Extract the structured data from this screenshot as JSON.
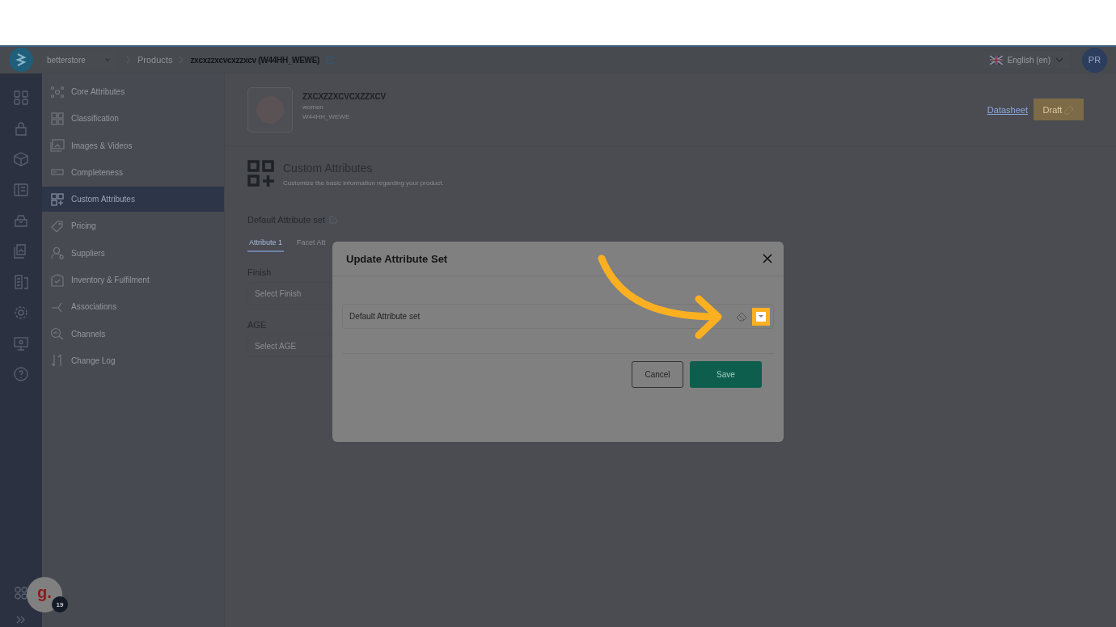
{
  "topbar": {
    "store": "betterstore",
    "breadcrumb": [
      "Products",
      "zxcxzzxcvcxzzxcv (W44HH_WEWE)"
    ],
    "language": "English (en)",
    "avatar": "PR"
  },
  "sidebar": {
    "items": [
      {
        "label": "Core Attributes",
        "selected": false
      },
      {
        "label": "Classification",
        "selected": false
      },
      {
        "label": "Images & Videos",
        "selected": false
      },
      {
        "label": "Completeness",
        "selected": false
      },
      {
        "label": "Custom Attributes",
        "selected": true
      },
      {
        "label": "Pricing",
        "selected": false
      },
      {
        "label": "Suppliers",
        "selected": false
      },
      {
        "label": "Inventory & Fulfilment",
        "selected": false
      },
      {
        "label": "Associations",
        "selected": false
      },
      {
        "label": "Channels",
        "selected": false
      },
      {
        "label": "Change Log",
        "selected": false
      }
    ]
  },
  "product": {
    "name": "ZXCXZZXCVCXZZXCV",
    "category": "women",
    "sku": "W44HH_WEWE",
    "link": "Datasheet",
    "status": "Draft"
  },
  "section": {
    "title": "Custom Attributes",
    "subtitle": "Customize the basic information regarding your product.",
    "attribute_set": "Default Attribute set"
  },
  "tabs": [
    {
      "label": "Attribute 1",
      "selected": true
    },
    {
      "label": "Facet Att",
      "selected": false
    }
  ],
  "fields": [
    {
      "label": "Finish",
      "placeholder": "Select Finish"
    },
    {
      "label": "AGE",
      "placeholder": "Select AGE"
    }
  ],
  "modal": {
    "title": "Update Attribute Set",
    "value": "Default Attribute set",
    "buttons": [
      {
        "label": "Cancel",
        "kind": "secondary"
      },
      {
        "label": "Save",
        "kind": "primary"
      }
    ]
  },
  "help_badge": {
    "logo": "g.",
    "count": "19"
  }
}
